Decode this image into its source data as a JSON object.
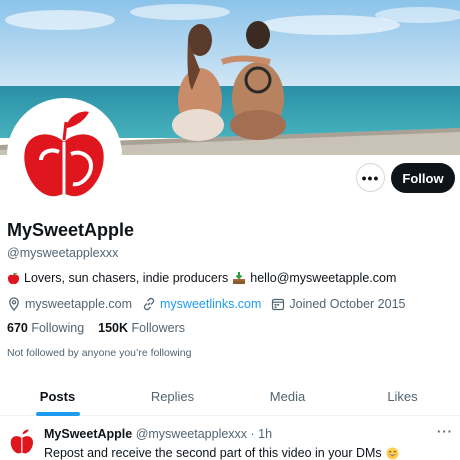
{
  "profile": {
    "name": "MySweetApple",
    "handle": "@mysweetapplexxx",
    "bio_part1": "Lovers, sun chasers, indie producers",
    "bio_email": "hello@mysweetapple.com",
    "website": "mysweetapple.com",
    "link": "mysweetlinks.com",
    "joined": "Joined October 2015",
    "following_count": "670",
    "following_label": "Following",
    "followers_count": "150K",
    "followers_label": "Followers",
    "not_followed": "Not followed by anyone you’re following"
  },
  "actions": {
    "more_label": "•••",
    "follow_label": "Follow"
  },
  "tabs": [
    {
      "label": "Posts",
      "active": true
    },
    {
      "label": "Replies",
      "active": false
    },
    {
      "label": "Media",
      "active": false
    },
    {
      "label": "Likes",
      "active": false
    }
  ],
  "tweet": {
    "name": "MySweetApple",
    "meta": "@mysweetapplexxx · 1h",
    "text": "Repost and receive the second part of this video in your DMs",
    "more": "···"
  },
  "colors": {
    "accent": "#1d9bf0",
    "brand_red": "#e0161e",
    "text": "#0f1419",
    "muted": "#536471"
  },
  "icons": [
    "apple-emoji-icon",
    "inbox-tray-emoji-icon",
    "location-icon",
    "link-icon",
    "calendar-icon",
    "grin-emoji-icon",
    "more-icon"
  ]
}
